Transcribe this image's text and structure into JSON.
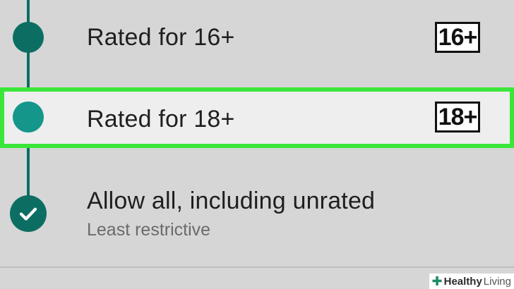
{
  "options": [
    {
      "label": "Rated for 16+",
      "badge": "16+"
    },
    {
      "label": "Rated for 18+",
      "badge": "18+"
    },
    {
      "label": "Allow all, including unrated",
      "sublabel": "Least restrictive"
    }
  ],
  "watermark": {
    "brand_bold": "Healthy",
    "brand_light": "Living"
  },
  "colors": {
    "background": "#d6d6d6",
    "timeline": "#0c6e63",
    "selected_dot": "#14968a",
    "highlight_border": "#3ae63a",
    "highlight_fill": "#eeeeee"
  },
  "icons": {
    "check": "check-icon",
    "watermark_plus": "plus-icon"
  }
}
